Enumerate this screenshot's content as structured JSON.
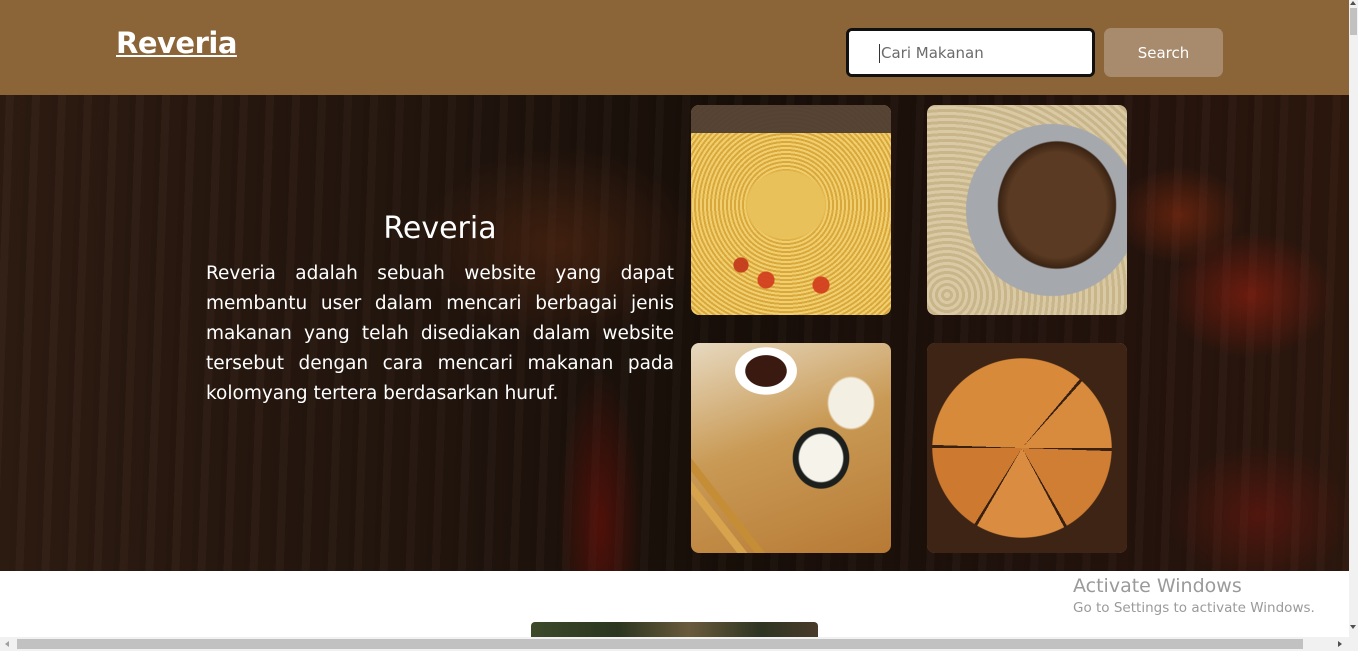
{
  "navbar": {
    "brand": "Reveria",
    "search": {
      "placeholder": "Cari Makanan",
      "value": ""
    },
    "search_button_label": "Search",
    "background_color": "#8b6438"
  },
  "hero": {
    "title": "Reveria",
    "description": "Reveria adalah sebuah website yang dapat membantu user dalam mencari berbagai jenis makanan yang telah disediakan dalam website tersebut dengan cara mencari makanan pada kolomyang tertera berdasarkan huruf.",
    "images": [
      {
        "name": "pasta"
      },
      {
        "name": "rendang"
      },
      {
        "name": "sushi"
      },
      {
        "name": "pizza"
      }
    ]
  },
  "os_watermark": {
    "title": "Activate Windows",
    "subtitle": "Go to Settings to activate Windows."
  }
}
